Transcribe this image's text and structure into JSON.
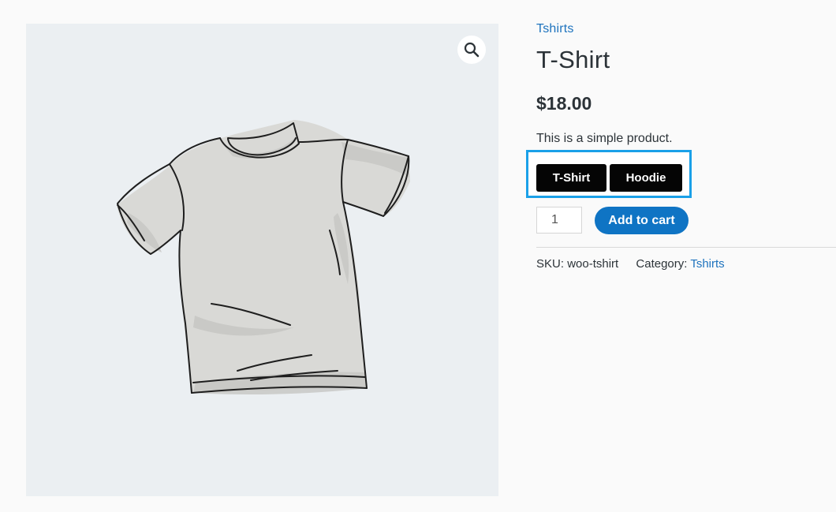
{
  "product": {
    "category_link": "Tshirts",
    "title": "T-Shirt",
    "price": "$18.00",
    "short_description": "This is a simple product.",
    "image_icon": "t-shirt-illustration"
  },
  "gallery": {
    "zoom_icon": "magnifier-icon"
  },
  "variations": {
    "options": [
      "T-Shirt",
      "Hoodie"
    ],
    "highlight_color": "#1aa0e8"
  },
  "cart": {
    "quantity": "1",
    "add_to_cart_label": "Add to cart",
    "button_color": "#0f74c4"
  },
  "meta": {
    "sku_label": "SKU:",
    "sku_value": "woo-tshirt",
    "category_label": "Category:",
    "category_value": "Tshirts"
  }
}
